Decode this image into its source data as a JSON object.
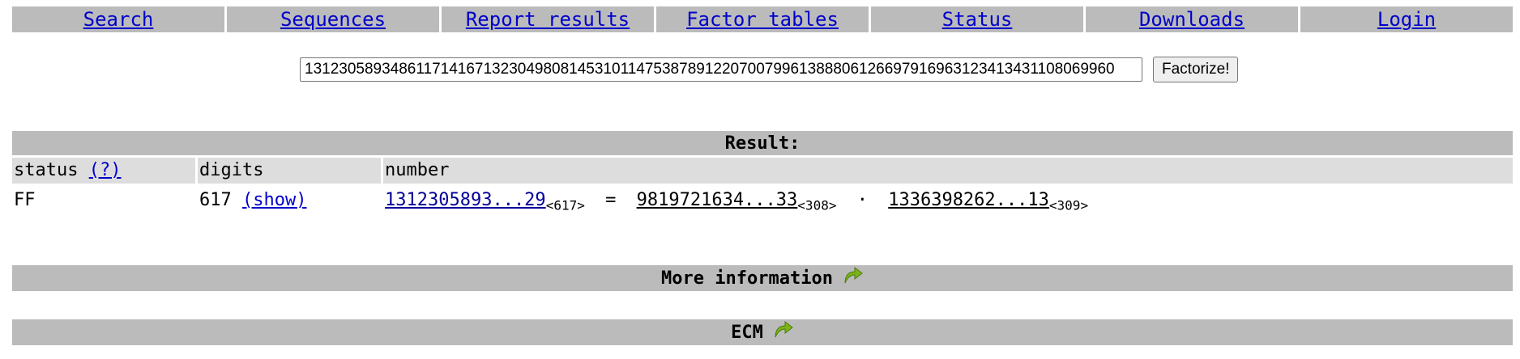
{
  "nav": {
    "items": [
      {
        "label": "Search"
      },
      {
        "label": "Sequences"
      },
      {
        "label": "Report results"
      },
      {
        "label": "Factor tables"
      },
      {
        "label": "Status"
      },
      {
        "label": "Downloads"
      },
      {
        "label": "Login"
      }
    ]
  },
  "form": {
    "number_value": "13123058934861171416713230498081453101147538789122070079961388806126697916963123413431108069960",
    "submit_label": "Factorize!"
  },
  "result": {
    "heading": "Result:",
    "columns": {
      "status": "status",
      "status_help": "(?)",
      "digits": "digits",
      "number": "number"
    },
    "row": {
      "status": "FF",
      "digits": "617",
      "show_label": "(show)",
      "number": "1312305893...29",
      "number_digits": "<617>",
      "equals": "=",
      "factor1": "9819721634...33",
      "factor1_digits": "<308>",
      "times": "·",
      "factor2": "1336398262...13",
      "factor2_digits": "<309>"
    }
  },
  "sections": {
    "more_info": "More information",
    "ecm": "ECM"
  },
  "icons": {
    "expand_arrow": "green-curved-arrow-icon"
  },
  "colors": {
    "bar": "#bbbbbb",
    "header_row": "#dddddd",
    "link": "#0000cc",
    "arrow": "#7ab317"
  }
}
